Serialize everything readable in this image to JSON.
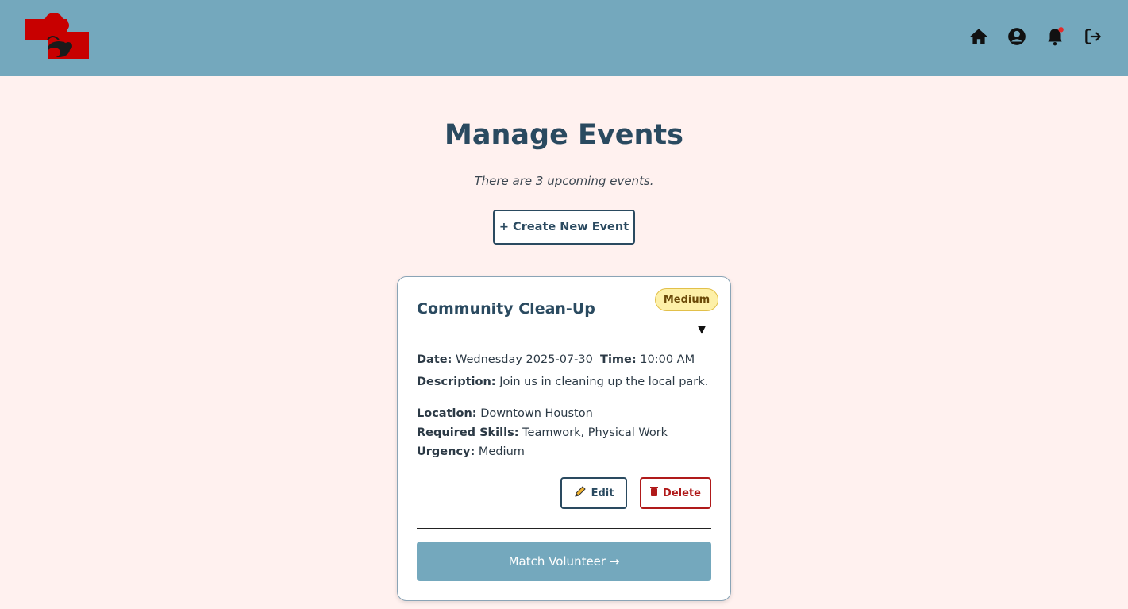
{
  "header": {
    "brand_color": "#74a8bd",
    "logo_name": "hands-logo",
    "icons": [
      "home-icon",
      "user-circle-icon",
      "bell-icon",
      "logout-icon"
    ],
    "notification_dot_color": "#e32b2b"
  },
  "page": {
    "title": "Manage Events",
    "subtitle": "There are 3 upcoming events.",
    "create_button": "+ Create New Event"
  },
  "event_card": {
    "title": "Community Clean-Up",
    "urgency_badge": "Medium",
    "toggle": "▼",
    "date_label": "Date:",
    "date_value": "Wednesday 2025-07-30",
    "time_label": "Time:",
    "time_value": "10:00 AM",
    "description_label": "Description:",
    "description_value": "Join us in cleaning up the local park.",
    "location_label": "Location:",
    "location_value": "Downtown Houston",
    "skills_label": "Required Skills:",
    "skills_value": "Teamwork, Physical Work",
    "urgency_label": "Urgency:",
    "urgency_value": "Medium",
    "edit_button": "Edit",
    "delete_button": "Delete",
    "match_button": "Match Volunteer →"
  },
  "colors": {
    "background": "#fff1ef",
    "heading": "#2a4a60",
    "delete": "#b01a1a",
    "badge_bg": "#fdf0a8"
  }
}
